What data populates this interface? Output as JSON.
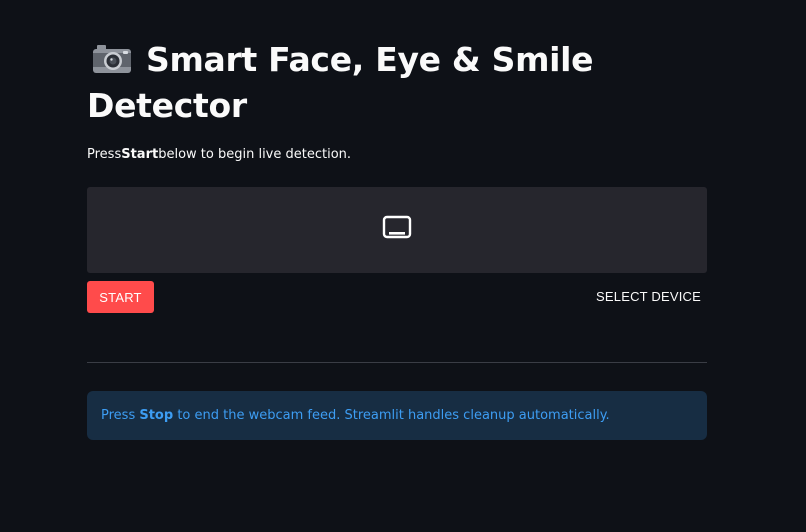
{
  "header": {
    "title": "Smart Face, Eye & Smile Detector",
    "title_icon": "camera-icon"
  },
  "caption": {
    "prefix": "Press ",
    "bold": "Start",
    "suffix": " below to begin live detection."
  },
  "webrtc": {
    "placeholder_icon": "monitor-icon",
    "start_label": "START",
    "select_device_label": "SELECT DEVICE"
  },
  "info": {
    "prefix": "Press ",
    "bold": "Stop",
    "suffix": " to end the webcam feed. Streamlit handles cleanup automatically."
  },
  "colors": {
    "background": "#0e1117",
    "start_button": "#ff4b4b",
    "info_background": "#172d43",
    "info_text": "#3d9df3"
  }
}
